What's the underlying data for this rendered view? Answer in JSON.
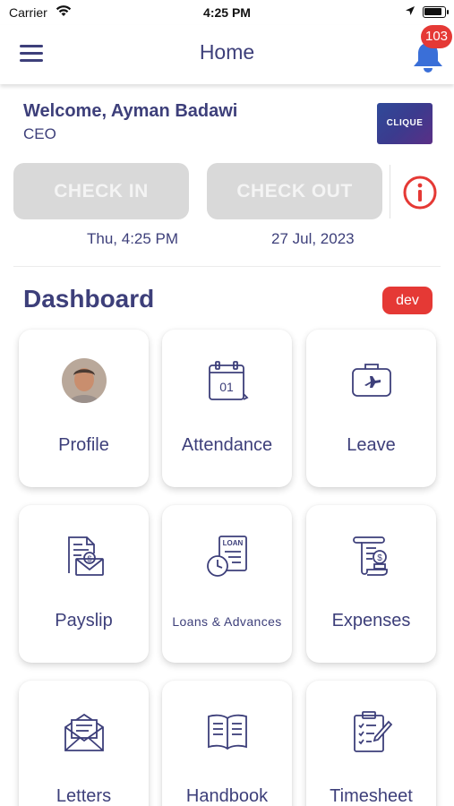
{
  "status_bar": {
    "carrier": "Carrier",
    "time": "4:25 PM"
  },
  "nav": {
    "title": "Home",
    "notification_count": "103"
  },
  "user": {
    "welcome": "Welcome, Ayman Badawi",
    "role": "CEO",
    "company_logo_text": "CLIQUE"
  },
  "attendance_actions": {
    "check_in_label": "CHECK IN",
    "check_out_label": "CHECK OUT",
    "time": "Thu, 4:25 PM",
    "date": "27 Jul, 2023"
  },
  "dashboard": {
    "title": "Dashboard",
    "environment_badge": "dev",
    "tiles": [
      {
        "label": "Profile",
        "icon": "avatar"
      },
      {
        "label": "Attendance",
        "icon": "calendar-icon"
      },
      {
        "label": "Leave",
        "icon": "suitcase-plane-icon"
      },
      {
        "label": "Payslip",
        "icon": "payslip-envelope-icon"
      },
      {
        "label": "Loans & Advances",
        "icon": "loan-clock-icon"
      },
      {
        "label": "Expenses",
        "icon": "receipt-coin-icon"
      },
      {
        "label": "Letters",
        "icon": "open-letter-icon"
      },
      {
        "label": "Handbook",
        "icon": "book-icon"
      },
      {
        "label": "Timesheet",
        "icon": "clipboard-pen-icon"
      }
    ]
  },
  "colors": {
    "primary_text": "#3d3f7a",
    "badge_red": "#e53935",
    "disabled_button": "#d9d9d9"
  }
}
